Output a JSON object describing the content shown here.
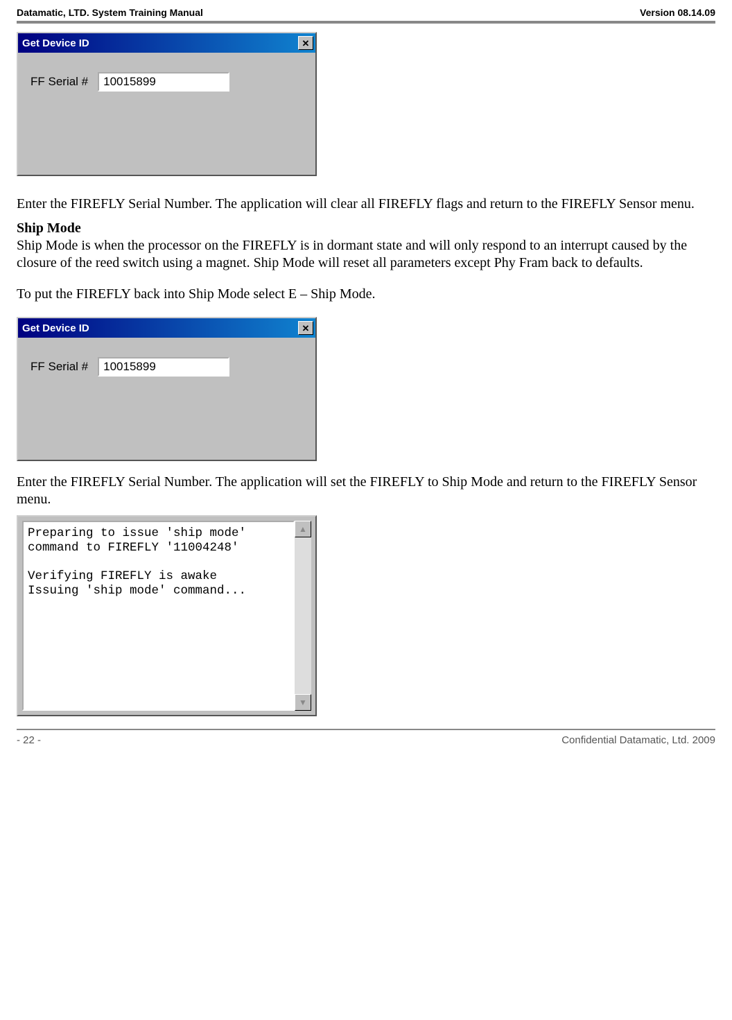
{
  "header": {
    "left": "Datamatic, LTD. System Training  Manual",
    "right": "Version 08.14.09"
  },
  "dialogs": {
    "get_device": {
      "title": "Get Device ID",
      "label": "FF Serial #",
      "value": "10015899"
    },
    "console": {
      "text": "Preparing to issue 'ship mode'\ncommand to FIREFLY '11004248'\n\nVerifying FIREFLY is awake\nIssuing 'ship mode' command..."
    }
  },
  "body": {
    "p1": "Enter the FIREFLY Serial Number.  The application will clear all FIREFLY flags and return to the FIREFLY Sensor menu.",
    "h1": "Ship Mode",
    "p2": "Ship Mode is when the processor on the FIREFLY is in dormant state and will only respond to an interrupt caused by the closure of the reed switch using a magnet.  Ship Mode will reset all parameters except Phy Fram back to defaults.",
    "p3": "To put the FIREFLY back into Ship Mode select E – Ship Mode.",
    "p4": "Enter the FIREFLY Serial Number.  The application will set the FIREFLY to Ship Mode and return to the FIREFLY Sensor menu."
  },
  "footer": {
    "left": "- 22 -",
    "right": "Confidential Datamatic, Ltd. 2009"
  },
  "icons": {
    "close": "✕",
    "up": "▲",
    "down": "▼"
  }
}
